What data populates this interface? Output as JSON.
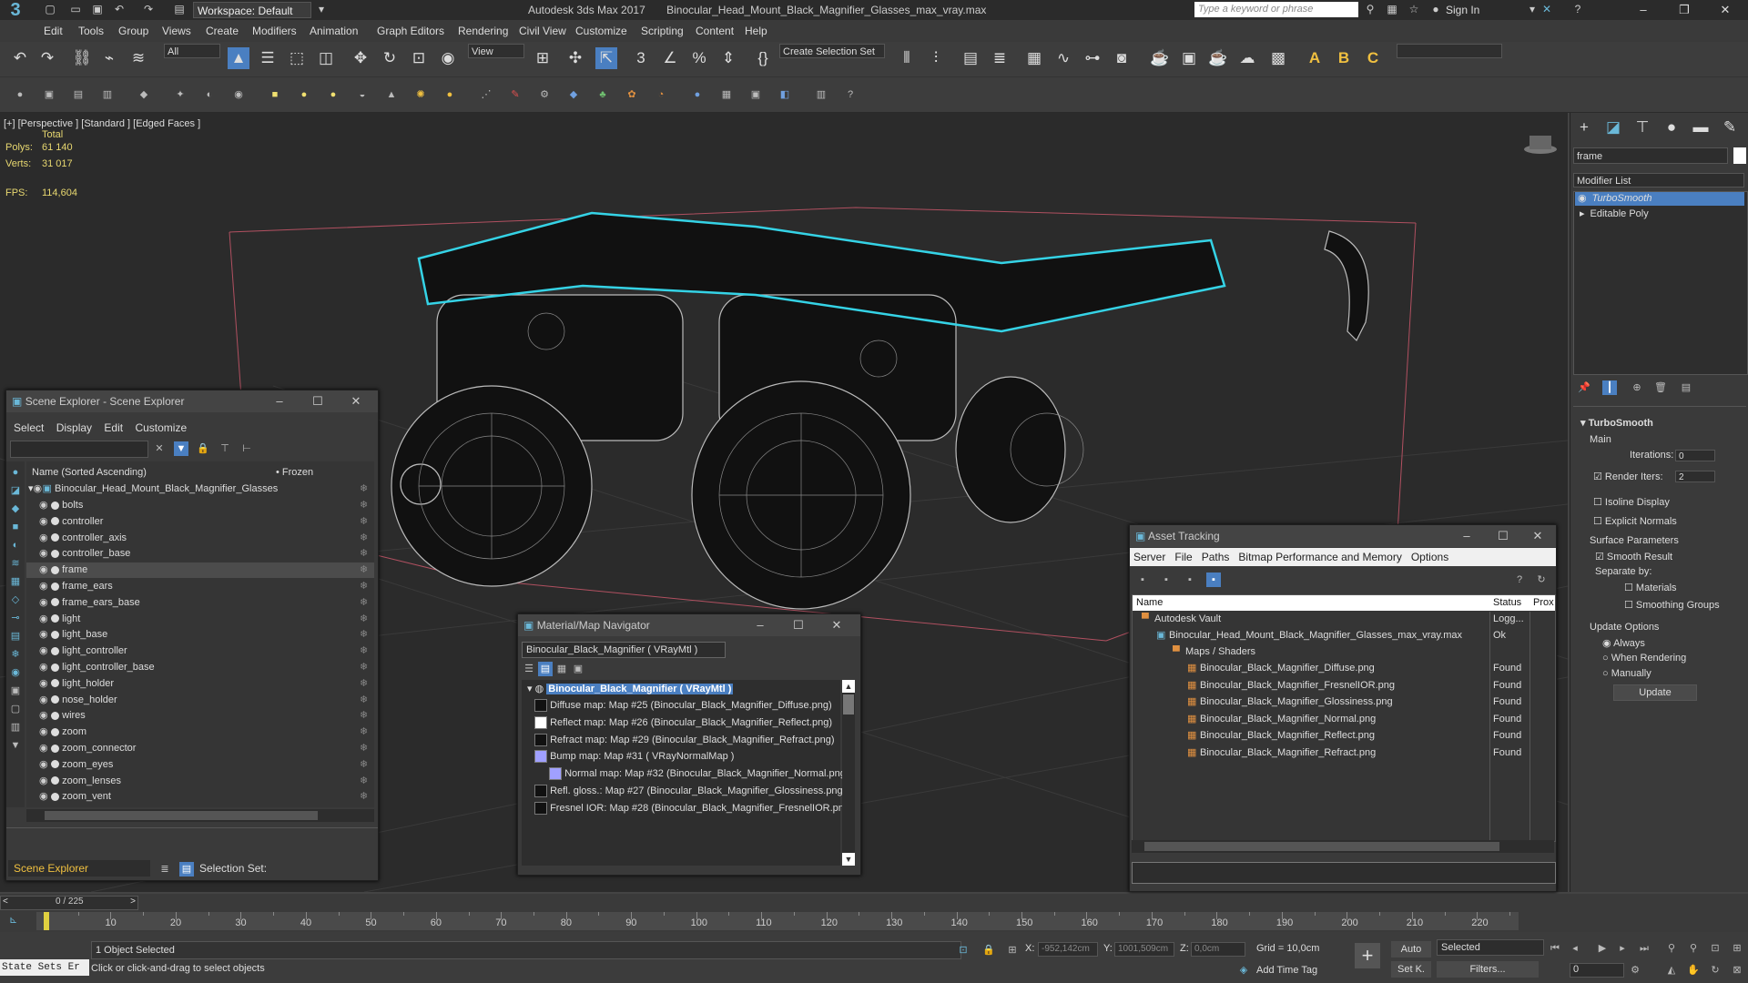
{
  "app": {
    "title": "Autodesk 3ds Max 2017",
    "filename": "Binocular_Head_Mount_Black_Magnifier_Glasses_max_vray.max",
    "workspace": "Workspace: Default",
    "search_placeholder": "Type a keyword or phrase",
    "sign_in": "Sign In"
  },
  "menu": [
    "Edit",
    "Tools",
    "Group",
    "Views",
    "Create",
    "Modifiers",
    "Animation",
    "Graph Editors",
    "Rendering",
    "Civil View",
    "Customize",
    "Scripting",
    "Content",
    "Help"
  ],
  "toolbar": {
    "filter": "All",
    "view": "View",
    "selection_set": "Create Selection Set"
  },
  "viewport": {
    "label": "[+] [Perspective ] [Standard ] [Edged Faces ]",
    "total": "Total",
    "polys_label": "Polys:",
    "polys": "61 140",
    "verts_label": "Verts:",
    "verts": "31 017",
    "fps_label": "FPS:",
    "fps": "114,604"
  },
  "command_panel": {
    "name_field": "frame",
    "modifier_list": "Modifier List",
    "stack": [
      "TurboSmooth",
      "Editable Poly"
    ],
    "rollout_title": "TurboSmooth",
    "main": "Main",
    "iterations_label": "Iterations:",
    "iterations": "0",
    "render_iters_label": "Render Iters:",
    "render_iters": "2",
    "isoline": "Isoline Display",
    "explicit": "Explicit Normals",
    "surface_params": "Surface Parameters",
    "smooth_result": "Smooth Result",
    "separate_by": "Separate by:",
    "materials": "Materials",
    "smoothing_groups": "Smoothing Groups",
    "update_options": "Update Options",
    "always": "Always",
    "when_rendering": "When Rendering",
    "manually": "Manually",
    "update_btn": "Update"
  },
  "scene_explorer": {
    "title": "Scene Explorer - Scene Explorer",
    "menu": [
      "Select",
      "Display",
      "Edit",
      "Customize"
    ],
    "col_name": "Name (Sorted Ascending)",
    "col_frozen": "Frozen",
    "root": "Binocular_Head_Mount_Black_Magnifier_Glasses",
    "items": [
      "bolts",
      "controller",
      "controller_axis",
      "controller_base",
      "frame",
      "frame_ears",
      "frame_ears_base",
      "light",
      "light_base",
      "light_controller",
      "light_controller_base",
      "light_holder",
      "nose_holder",
      "wires",
      "zoom",
      "zoom_connector",
      "zoom_eyes",
      "zoom_lenses",
      "zoom_vent"
    ],
    "footer_label": "Scene Explorer",
    "selection_set": "Selection Set:"
  },
  "material_nav": {
    "title": "Material/Map Navigator",
    "current": "Binocular_Black_Magnifier  ( VRayMtl )",
    "root": "Binocular_Black_Magnifier  ( VRayMtl )",
    "maps": [
      "Diffuse map: Map #25 (Binocular_Black_Magnifier_Diffuse.png)",
      "Reflect map: Map #26 (Binocular_Black_Magnifier_Reflect.png)",
      "Refract map: Map #29 (Binocular_Black_Magnifier_Refract.png)",
      "Bump map: Map #31  ( VRayNormalMap )",
      "Normal map: Map #32 (Binocular_Black_Magnifier_Normal.png)",
      "Refl. gloss.: Map #27 (Binocular_Black_Magnifier_Glossiness.png)",
      "Fresnel IOR: Map #28 (Binocular_Black_Magnifier_FresnelIOR.png)"
    ]
  },
  "asset_tracking": {
    "title": "Asset Tracking",
    "menu": [
      "Server",
      "File",
      "Paths",
      "Bitmap Performance and Memory",
      "Options"
    ],
    "col_name": "Name",
    "col_status": "Status",
    "col_proxy": "Prox",
    "vault": "Autodesk Vault",
    "vault_status": "Logg...",
    "file": "Binocular_Head_Mount_Black_Magnifier_Glasses_max_vray.max",
    "file_status": "Ok",
    "maps_folder": "Maps / Shaders",
    "maps": [
      "Binocular_Black_Magnifier_Diffuse.png",
      "Binocular_Black_Magnifier_FresnelIOR.png",
      "Binocular_Black_Magnifier_Glossiness.png",
      "Binocular_Black_Magnifier_Normal.png",
      "Binocular_Black_Magnifier_Reflect.png",
      "Binocular_Black_Magnifier_Refract.png"
    ],
    "map_status": "Found"
  },
  "timeline": {
    "frame": "0 / 225",
    "ticks": [
      "10",
      "20",
      "30",
      "40",
      "50",
      "60",
      "70",
      "80",
      "90",
      "100",
      "110",
      "120",
      "130",
      "140",
      "150",
      "160",
      "170",
      "180",
      "190",
      "200",
      "210",
      "220"
    ]
  },
  "status": {
    "state_sets": "State Sets Er",
    "selected": "1 Object Selected",
    "hint": "Click or click-and-drag to select objects",
    "x_label": "X:",
    "x": "-952,142cm",
    "y_label": "Y:",
    "y": "1001,509cm",
    "z_label": "Z:",
    "z": "0,0cm",
    "grid": "Grid = 10,0cm",
    "add_time_tag": "Add Time Tag",
    "auto": "Auto",
    "selected_dd": "Selected",
    "set_k": "Set K.",
    "filters": "Filters...",
    "frame_spinner": "0"
  },
  "colors": {
    "accent": "#4a7fc1",
    "selection": "#35d3e6",
    "stat": "#e8d870"
  }
}
